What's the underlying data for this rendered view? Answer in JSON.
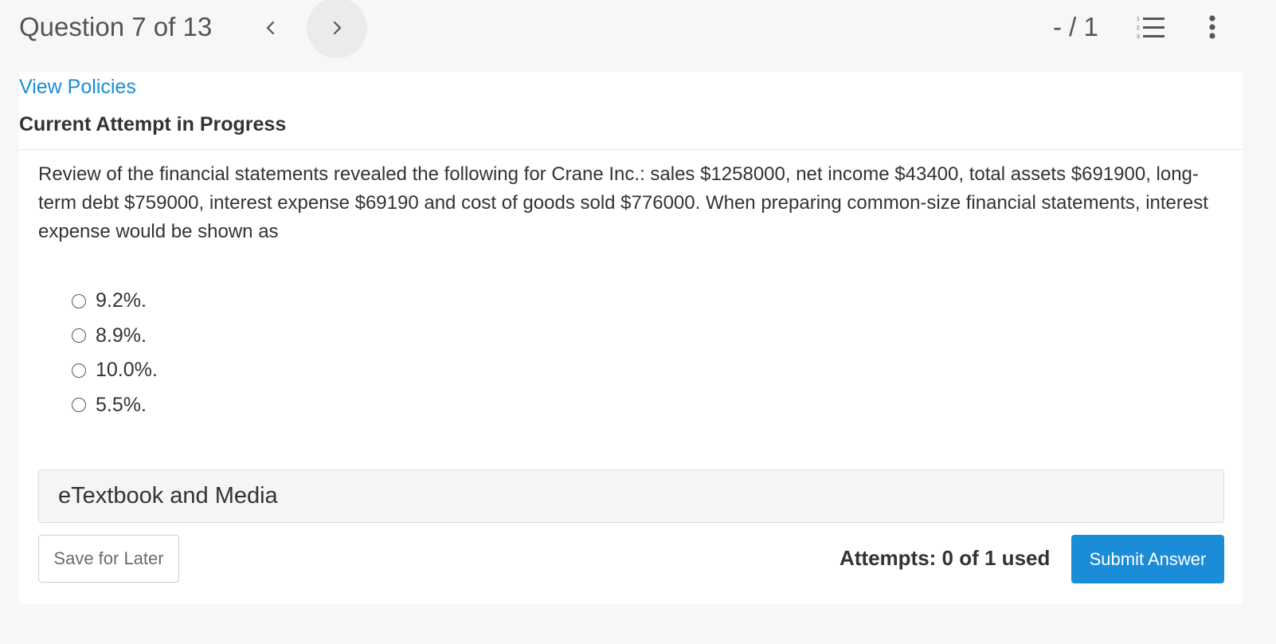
{
  "header": {
    "question_title": "Question 7 of 13",
    "score": "- / 1",
    "icons": {
      "previous": "chevron-left-icon",
      "next": "chevron-right-icon",
      "list": "numbered-list-icon",
      "more": "more-vertical-icon"
    }
  },
  "links": {
    "view_policies": "View Policies"
  },
  "attempt_heading": "Current Attempt in Progress",
  "question": {
    "text": "Review of the financial statements revealed the following for Crane Inc.: sales $1258000, net income $43400, total assets $691900, long-term debt $759000, interest expense $69190 and cost of goods sold $776000. When preparing common-size financial statements, interest expense would be shown as",
    "options": [
      {
        "label": "9.2%."
      },
      {
        "label": "8.9%."
      },
      {
        "label": "10.0%."
      },
      {
        "label": "5.5%."
      }
    ]
  },
  "etextbook": {
    "label": "eTextbook and Media"
  },
  "footer": {
    "save_label": "Save for Later",
    "attempts_text": "Attempts: 0 of 1 used",
    "submit_label": "Submit Answer"
  },
  "colors": {
    "accent": "#1a8cd8",
    "page_background": "#f7f7f7",
    "card_background": "#ffffff",
    "text": "#333333"
  }
}
